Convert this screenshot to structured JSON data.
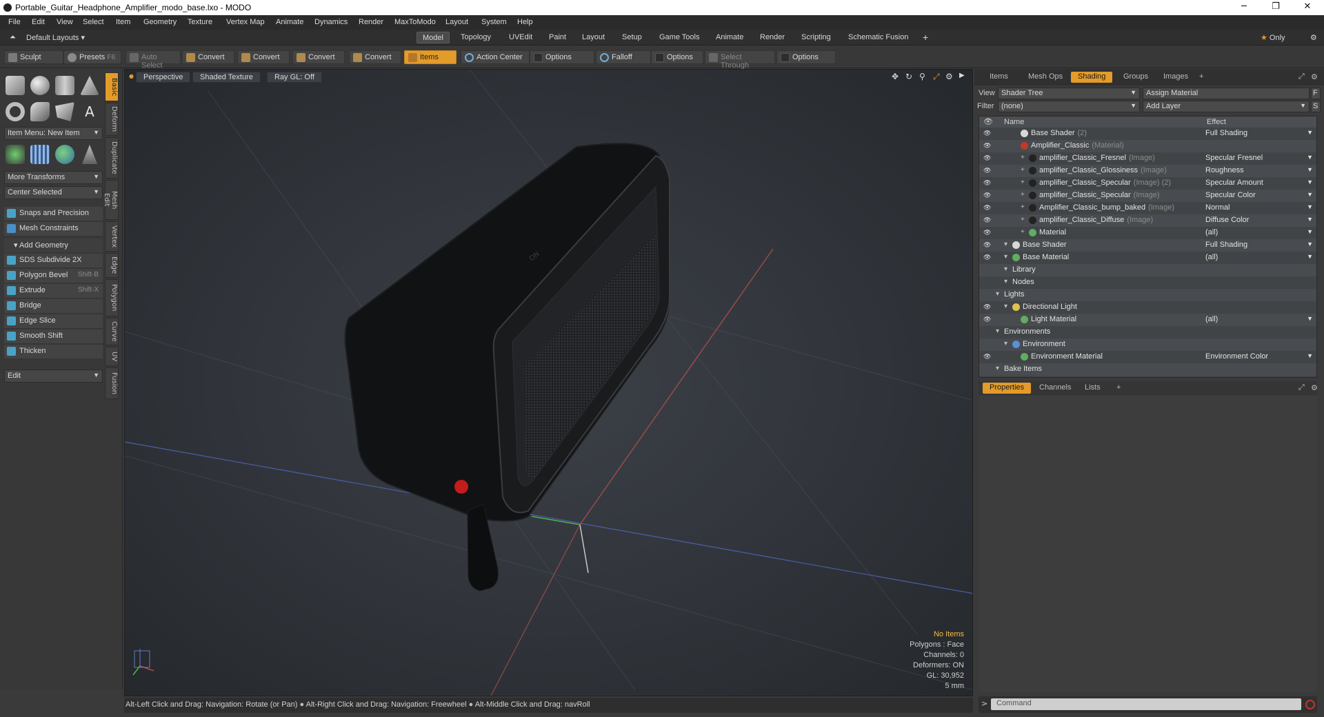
{
  "window": {
    "title": "Portable_Guitar_Headphone_Amplifier_modo_base.lxo - MODO",
    "minimize": "─",
    "maximize": "❐",
    "close": "✕"
  },
  "menu": [
    "File",
    "Edit",
    "View",
    "Select",
    "Item",
    "Geometry",
    "Texture",
    "Vertex Map",
    "Animate",
    "Dynamics",
    "Render",
    "MaxToModo",
    "Layout",
    "System",
    "Help"
  ],
  "layoutbar": {
    "layouts_label": "Default Layouts",
    "tabs": [
      "Model",
      "Topology",
      "UVEdit",
      "Paint",
      "Layout",
      "Setup",
      "Game Tools",
      "Animate",
      "Render",
      "Scripting",
      "Schematic Fusion"
    ],
    "active_tab": "Model",
    "add": "+",
    "only_label": "Only"
  },
  "toolbar": {
    "sculpt": "Sculpt",
    "presets": "Presets",
    "presets_shortcut": "F6",
    "auto_select": "Auto Select",
    "convert1": "Convert",
    "convert2": "Convert",
    "convert3": "Convert",
    "convert4": "Convert",
    "items": "Items",
    "action_center": "Action Center",
    "options1": "Options",
    "falloff": "Falloff",
    "options2": "Options",
    "select_through": "Select Through",
    "options3": "Options"
  },
  "left": {
    "vtabs": [
      "Basic",
      "Deform",
      "Duplicate",
      "Mesh Edit",
      "Vertex",
      "Edge",
      "Polygon",
      "Curve",
      "UV",
      "Fusion"
    ],
    "item_menu": "Item Menu: New Item",
    "more_transforms": "More Transforms",
    "center_selected": "Center Selected",
    "snaps": "Snaps and Precision",
    "mesh_constraints": "Mesh Constraints",
    "add_geometry": "Add Geometry",
    "tools": [
      {
        "label": "SDS Subdivide 2X",
        "shortcut": ""
      },
      {
        "label": "Polygon Bevel",
        "shortcut": "Shift-B"
      },
      {
        "label": "Extrude",
        "shortcut": "Shift-X"
      },
      {
        "label": "Bridge",
        "shortcut": ""
      },
      {
        "label": "Edge Slice",
        "shortcut": ""
      },
      {
        "label": "Smooth Shift",
        "shortcut": ""
      },
      {
        "label": "Thicken",
        "shortcut": ""
      }
    ],
    "edit_dropdown": "Edit"
  },
  "viewport": {
    "perspective": "Perspective",
    "shading": "Shaded Texture",
    "raygl": "Ray GL: Off",
    "info": {
      "no_items": "No Items",
      "polygons": "Polygons : Face",
      "channels": "Channels: 0",
      "deformers": "Deformers: ON",
      "gl": "GL: 30,952",
      "scale": "5 mm"
    }
  },
  "status": {
    "hint1": "Alt-Left Click and Drag: Navigation: Rotate (or Pan)",
    "hint2": "Alt-Right Click and Drag: Navigation: Freewheel",
    "hint3": "Alt-Middle Click and Drag: navRoll"
  },
  "right": {
    "tabs": [
      "Items",
      "Mesh Ops",
      "Shading",
      "Groups",
      "Images",
      "+"
    ],
    "active_tab": "Shading",
    "view_label": "View",
    "view_value": "Shader Tree",
    "assign_material": "Assign Material",
    "f_btn": "F",
    "filter_label": "Filter",
    "filter_value": "(none)",
    "add_layer": "Add Layer",
    "s_btn": "S",
    "col_name": "Name",
    "col_effect": "Effect",
    "rows": [
      {
        "name": "Base Shader",
        "suffix": "(2)",
        "effect": "Full Shading",
        "indent": 3,
        "dot": "#d8d8d8",
        "eye": true
      },
      {
        "name": "Amplifier_Classic",
        "suffix": "(Material)",
        "effect": "",
        "indent": 3,
        "dot": "#c0392b",
        "eye": true
      },
      {
        "name": "amplifier_Classic_Fresnel",
        "suffix": "(Image)",
        "effect": "Specular Fresnel",
        "indent": 4,
        "dot": "#222",
        "eye": true
      },
      {
        "name": "amplifier_Classic_Glossiness",
        "suffix": "(Image)",
        "effect": "Roughness",
        "indent": 4,
        "dot": "#222",
        "eye": true
      },
      {
        "name": "amplifier_Classic_Specular",
        "suffix": "(Image) (2)",
        "effect": "Specular Amount",
        "indent": 4,
        "dot": "#222",
        "eye": true
      },
      {
        "name": "amplifier_Classic_Specular",
        "suffix": "(Image)",
        "effect": "Specular Color",
        "indent": 4,
        "dot": "#222",
        "eye": true
      },
      {
        "name": "Amplifier_Classic_bump_baked",
        "suffix": "(Image)",
        "effect": "Normal",
        "indent": 4,
        "dot": "#222",
        "eye": true
      },
      {
        "name": "amplifier_Classic_Diffuse",
        "suffix": "(Image)",
        "effect": "Diffuse Color",
        "indent": 4,
        "dot": "#222",
        "eye": true
      },
      {
        "name": "Material",
        "suffix": "",
        "effect": "(all)",
        "indent": 4,
        "dot": "#5fae5f",
        "eye": true
      },
      {
        "name": "Base Shader",
        "suffix": "",
        "effect": "Full Shading",
        "indent": 2,
        "dot": "#d8d8d8",
        "eye": true
      },
      {
        "name": "Base Material",
        "suffix": "",
        "effect": "(all)",
        "indent": 2,
        "dot": "#5fae5f",
        "eye": true
      },
      {
        "name": "Library",
        "suffix": "",
        "effect": "",
        "indent": 2,
        "dot": "",
        "eye": false
      },
      {
        "name": "Nodes",
        "suffix": "",
        "effect": "",
        "indent": 2,
        "dot": "",
        "eye": false
      },
      {
        "name": "Lights",
        "suffix": "",
        "effect": "",
        "indent": 1,
        "dot": "",
        "eye": false
      },
      {
        "name": "Directional Light",
        "suffix": "",
        "effect": "",
        "indent": 2,
        "dot": "#e0c050",
        "eye": true
      },
      {
        "name": "Light Material",
        "suffix": "",
        "effect": "(all)",
        "indent": 3,
        "dot": "#5fae5f",
        "eye": true
      },
      {
        "name": "Environments",
        "suffix": "",
        "effect": "",
        "indent": 1,
        "dot": "",
        "eye": false
      },
      {
        "name": "Environment",
        "suffix": "",
        "effect": "",
        "indent": 2,
        "dot": "#5b8fd6",
        "eye": false
      },
      {
        "name": "Environment Material",
        "suffix": "",
        "effect": "Environment Color",
        "indent": 3,
        "dot": "#5fae5f",
        "eye": true
      },
      {
        "name": "Bake Items",
        "suffix": "",
        "effect": "",
        "indent": 1,
        "dot": "",
        "eye": false
      }
    ],
    "props_tabs": [
      "Properties",
      "Channels",
      "Lists",
      "+"
    ],
    "command_placeholder": "Command"
  },
  "colors": {
    "accent": "#e39b2a",
    "panel": "#383838",
    "viewport": "#30343a"
  }
}
